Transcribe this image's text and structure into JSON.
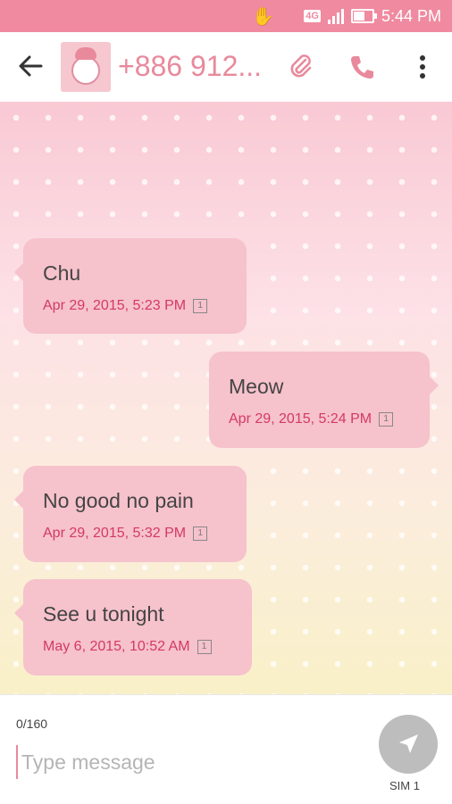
{
  "status_bar": {
    "network": "4G",
    "time": "5:44 PM",
    "battery_level": 0.55,
    "signal_bars": 4
  },
  "toolbar": {
    "contact": "+886 912...",
    "back_icon": "arrow-left-icon",
    "attach_icon": "paperclip-icon",
    "call_icon": "phone-icon",
    "more_icon": "more-vert-icon"
  },
  "colors": {
    "accent": "#e9899c",
    "status_bar": "#ef8aa0",
    "bubble": "#f6c2cc",
    "timestamp": "#d33a63",
    "send_button": "#bdbdbd"
  },
  "messages": [
    {
      "text": "Chu",
      "time": "Apr 29, 2015, 5:23 PM",
      "sim": "1",
      "direction": "incoming"
    },
    {
      "text": "Meow",
      "time": "Apr 29, 2015, 5:24 PM",
      "sim": "1",
      "direction": "outgoing"
    },
    {
      "text": "No good no pain",
      "time": "Apr 29, 2015, 5:32 PM",
      "sim": "1",
      "direction": "incoming"
    },
    {
      "text": "See u tonight",
      "time": "May 6, 2015, 10:52 AM",
      "sim": "1",
      "direction": "incoming"
    }
  ],
  "composer": {
    "counter": "0/160",
    "placeholder": "Type message",
    "value": "",
    "send_label": "SIM 1"
  }
}
